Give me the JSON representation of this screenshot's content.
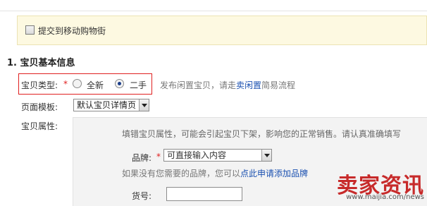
{
  "mobile": {
    "checkbox_label": "提交到移动购物街",
    "checked": false
  },
  "section": {
    "title": "1. 宝贝基本信息"
  },
  "item_type": {
    "label": "宝贝类型:",
    "required_mark": "*",
    "options": [
      {
        "label": "全新",
        "checked": false
      },
      {
        "label": "二手",
        "checked": true
      }
    ],
    "hint_prefix": "发布闲置宝贝，请走",
    "hint_link": "卖闲置",
    "hint_suffix": "简易流程"
  },
  "template": {
    "label": "页面模板:",
    "selected": "默认宝贝详情页"
  },
  "attributes": {
    "label": "宝贝属性:",
    "warning": "填错宝贝属性，可能会引起宝贝下架，影响您的正常销售。请认真准确填写",
    "brand_label": "品牌:",
    "required_mark": "*",
    "brand_placeholder": "可直接输入内容",
    "brand_hint_prefix": "如果没有您需要的品牌，您可以",
    "brand_hint_link": "点此申请添加品牌",
    "sku_label": "货号:"
  },
  "watermark": {
    "text": "卖家资讯",
    "url": "www.maijia.com/news"
  },
  "colors": {
    "required": "#e02020",
    "link": "#1a50b0",
    "highlight_box": "#e02020",
    "notice_bg": "#fdf9e1",
    "watermark": "#c41a1a"
  }
}
